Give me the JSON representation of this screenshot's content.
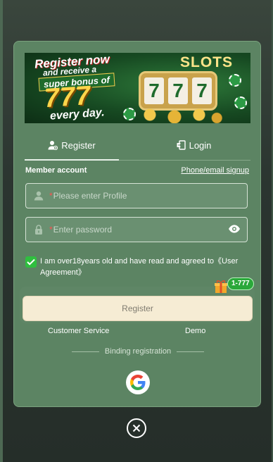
{
  "banner": {
    "line1": "Register now",
    "line2": "and receive a",
    "line3": "super bonus of",
    "amount": "777",
    "line5": "every day.",
    "slots_text": "SLOTS",
    "reels": [
      "7",
      "7",
      "7"
    ]
  },
  "tabs": [
    {
      "label": "Register",
      "icon": "user-add-icon",
      "active": true
    },
    {
      "label": "Login",
      "icon": "door-enter-icon",
      "active": false
    }
  ],
  "form": {
    "account_label": "Member account",
    "alt_signup_link": "Phone/email signup",
    "profile_placeholder": "Please enter Profile",
    "password_placeholder": "Enter password",
    "required_mark": "*",
    "agreement_text": "I am over18years old and have read and agreed to《User Agreement》",
    "agreement_checked": true,
    "submit_label": "Register",
    "bonus_badge": "1-777"
  },
  "footer": {
    "customer_service": "Customer Service",
    "demo": "Demo",
    "binding_label": "Binding registration"
  },
  "colors": {
    "modal_bg": "#5c8463",
    "button_bg": "#f6ecd4",
    "check": "#2fbf3f",
    "required": "#ff4f4f"
  }
}
